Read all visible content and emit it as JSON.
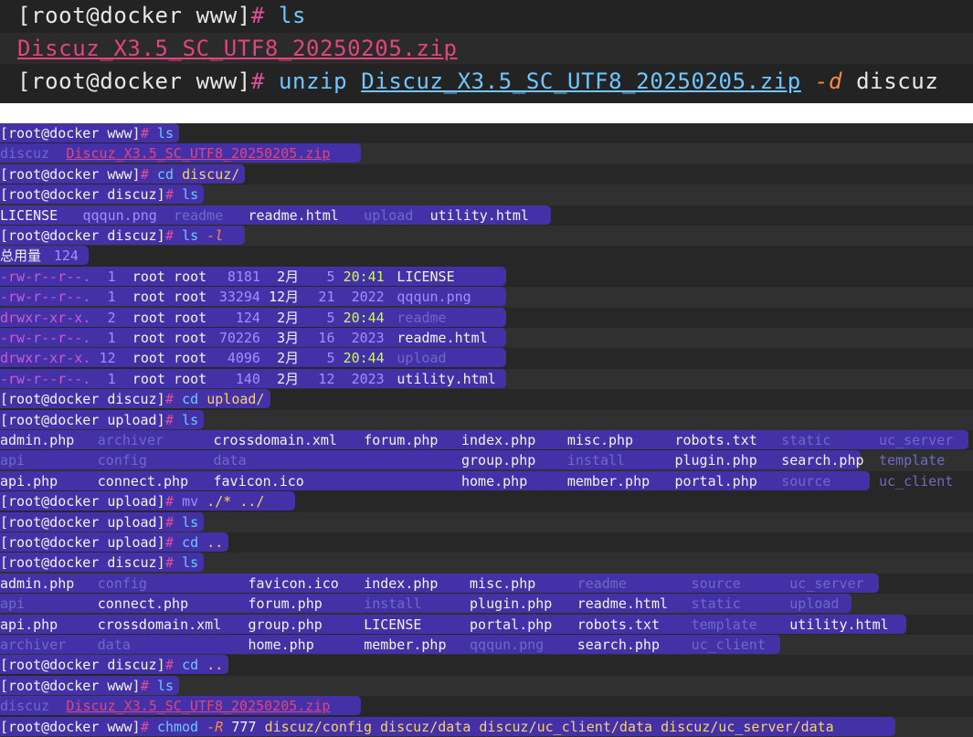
{
  "top": {
    "prompt1": "[root@docker www]",
    "hash": "#",
    "cmd1": "ls",
    "zip": "Discuz_X3.5_SC_UTF8_20250205.zip",
    "prompt2": "[root@docker www]",
    "unzip": "unzip",
    "opt": "-d",
    "dest": "discuz"
  },
  "lines": {
    "l1_prompt": "[root@docker www]",
    "l1_cmd": "ls",
    "l2_dir": "discuz",
    "l2_zip": "Discuz_X3.5_SC_UTF8_20250205.zip",
    "l3_prompt": "[root@docker www]",
    "l3_cmd": "cd",
    "l3_arg": "discuz/",
    "l4_prompt": "[root@docker discuz]",
    "l4_cmd": "ls",
    "l5_items": [
      "LICENSE",
      "qqqun.png",
      "readme",
      "readme.html",
      "upload",
      "utility.html"
    ],
    "l6_prompt": "[root@docker discuz]",
    "l6_cmd": "ls",
    "l6_opt": "-l",
    "l7_total": "总用量",
    "l7_num": "124",
    "longlist": [
      {
        "perm": "-rw-r--r--.",
        "links": "1",
        "user": "root",
        "group": "root",
        "size": "8181",
        "mon": "2月",
        "day": "5",
        "time": "20:41",
        "name": "LICENSE"
      },
      {
        "perm": "-rw-r--r--.",
        "links": "1",
        "user": "root",
        "group": "root",
        "size": "33294",
        "mon": "12月",
        "day": "21",
        "time": "2022",
        "name": "qqqun.png"
      },
      {
        "perm": "drwxr-xr-x.",
        "links": "2",
        "user": "root",
        "group": "root",
        "size": "124",
        "mon": "2月",
        "day": "5",
        "time": "20:44",
        "name": "readme"
      },
      {
        "perm": "-rw-r--r--.",
        "links": "1",
        "user": "root",
        "group": "root",
        "size": "70226",
        "mon": "3月",
        "day": "16",
        "time": "2023",
        "name": "readme.html"
      },
      {
        "perm": "drwxr-xr-x.",
        "links": "12",
        "user": "root",
        "group": "root",
        "size": "4096",
        "mon": "2月",
        "day": "5",
        "time": "20:44",
        "name": "upload"
      },
      {
        "perm": "-rw-r--r--.",
        "links": "1",
        "user": "root",
        "group": "root",
        "size": "140",
        "mon": "2月",
        "day": "12",
        "time": "2023",
        "name": "utility.html"
      }
    ],
    "l14_prompt": "[root@docker discuz]",
    "l14_cmd": "cd",
    "l14_arg": "upload/",
    "l15_prompt": "[root@docker upload]",
    "l15_cmd": "ls",
    "grid1": [
      [
        "admin.php",
        "archiver",
        "crossdomain.xml",
        "forum.php",
        "index.php",
        "misc.php",
        "robots.txt",
        "static",
        "uc_server"
      ],
      [
        "api",
        "config",
        "data",
        "",
        "group.php",
        "install",
        "plugin.php",
        "search.php",
        "template"
      ],
      [
        "api.php",
        "connect.php",
        "favicon.ico",
        "",
        "home.php",
        "member.php",
        "portal.php",
        "source",
        "uc_client"
      ]
    ],
    "l19_prompt": "[root@docker upload]",
    "l19_cmd": "mv",
    "l19_arg": "./* ../",
    "l20_prompt": "[root@docker upload]",
    "l20_cmd": "ls",
    "l21_prompt": "[root@docker upload]",
    "l21_cmd": "cd",
    "l21_arg": "..",
    "l22_prompt": "[root@docker discuz]",
    "l22_cmd": "ls",
    "grid2": [
      [
        "admin.php",
        "config",
        "favicon.ico",
        "index.php",
        "misc.php",
        "readme",
        "source",
        "uc_server"
      ],
      [
        "api",
        "connect.php",
        "forum.php",
        "install",
        "plugin.php",
        "readme.html",
        "static",
        "upload"
      ],
      [
        "api.php",
        "crossdomain.xml",
        "group.php",
        "LICENSE",
        "portal.php",
        "robots.txt",
        "template",
        "utility.html"
      ],
      [
        "archiver",
        "data",
        "home.php",
        "member.php",
        "qqqun.png",
        "search.php",
        "uc_client",
        ""
      ]
    ],
    "l27_prompt": "[root@docker discuz]",
    "l27_cmd": "cd",
    "l27_arg": "..",
    "l28_prompt": "[root@docker www]",
    "l28_cmd": "ls",
    "l29_dir": "discuz",
    "l29_zip": "Discuz_X3.5_SC_UTF8_20250205.zip",
    "l30_prompt": "[root@docker www]",
    "l30_cmd": "chmod",
    "l30_opt": "-R",
    "l30_mode": "777",
    "l30_args": "discuz/config discuz/data discuz/uc_client/data discuz/uc_server/data"
  },
  "colors": {
    "selection": "#4431a8",
    "directory": "#6d69c9",
    "prompt_hash": "#e05096",
    "command": "#6ec7ff",
    "argument": "#f3d36a"
  }
}
